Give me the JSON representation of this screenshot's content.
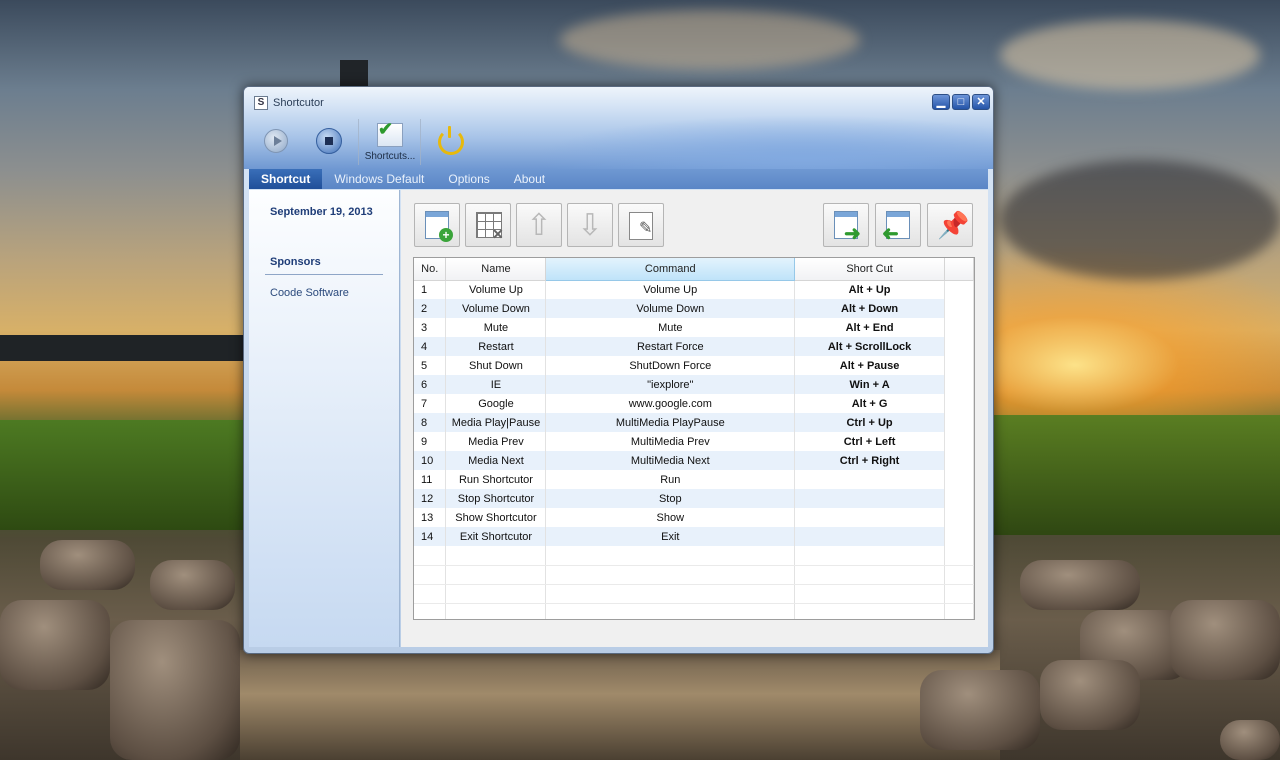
{
  "window": {
    "icon_letter": "S",
    "title": "Shortcutor",
    "controls": {
      "minimize": "▁",
      "maximize": "□",
      "close": "✕"
    }
  },
  "toolbar": {
    "shortcuts_label": "Shortcuts..."
  },
  "tabs": [
    {
      "label": "Shortcut",
      "active": true
    },
    {
      "label": "Windows Default",
      "active": false
    },
    {
      "label": "Options",
      "active": false
    },
    {
      "label": "About",
      "active": false
    }
  ],
  "sidebar": {
    "date": "September 19, 2013",
    "sponsors_heading": "Sponsors",
    "sponsor_link": "Coode Software"
  },
  "table": {
    "columns": [
      "No.",
      "Name",
      "Command",
      "Short Cut"
    ],
    "rows": [
      [
        "1",
        "Volume Up",
        "Volume Up",
        "Alt + Up"
      ],
      [
        "2",
        "Volume Down",
        "Volume Down",
        "Alt + Down"
      ],
      [
        "3",
        "Mute",
        "Mute",
        "Alt + End"
      ],
      [
        "4",
        "Restart",
        "Restart Force",
        "Alt + ScrollLock"
      ],
      [
        "5",
        "Shut Down",
        "ShutDown Force",
        "Alt + Pause"
      ],
      [
        "6",
        "IE",
        "\"iexplore\"",
        "Win + A"
      ],
      [
        "7",
        "Google",
        "www.google.com",
        "Alt + G"
      ],
      [
        "8",
        "Media Play|Pause",
        "MultiMedia PlayPause",
        "Ctrl + Up"
      ],
      [
        "9",
        "Media Prev",
        "MultiMedia Prev",
        "Ctrl + Left"
      ],
      [
        "10",
        "Media Next",
        "MultiMedia Next",
        "Ctrl + Right"
      ],
      [
        "11",
        "Run Shortcutor",
        "Run",
        ""
      ],
      [
        "12",
        "Stop Shortcutor",
        "Stop",
        ""
      ],
      [
        "13",
        "Show Shortcutor",
        "Show",
        ""
      ],
      [
        "14",
        "Exit Shortcutor",
        "Exit",
        ""
      ]
    ]
  },
  "colors": {
    "accent": "#1f4f99",
    "row_alt": "#e8f1fb",
    "sorted_header": "#bfe3f9"
  }
}
